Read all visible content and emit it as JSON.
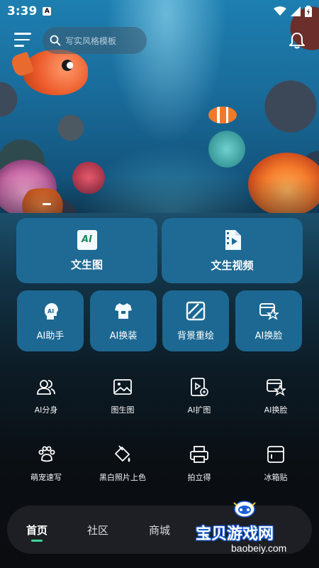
{
  "status_bar": {
    "time": "3:39",
    "badge": "A"
  },
  "header": {
    "search_placeholder": "写实风格模板"
  },
  "big_tiles": [
    {
      "label": "文生图",
      "icon": "ai-text-image-icon",
      "icon_text": "AI"
    },
    {
      "label": "文生视频",
      "icon": "text-video-icon"
    }
  ],
  "mid_tiles": [
    {
      "label": "AI助手",
      "icon": "ai-assistant-icon"
    },
    {
      "label": "AI换装",
      "icon": "outfit-icon"
    },
    {
      "label": "背景重绘",
      "icon": "background-repaint-icon"
    },
    {
      "label": "AI换脸",
      "icon": "face-swap-icon"
    }
  ],
  "grid_items": [
    {
      "label": "AI分身",
      "icon": "clone-users-icon"
    },
    {
      "label": "图生图",
      "icon": "image-icon"
    },
    {
      "label": "AI扩图",
      "icon": "expand-image-icon"
    },
    {
      "label": "AI换脸",
      "icon": "face-swap-icon"
    },
    {
      "label": "萌宠速写",
      "icon": "paw-icon"
    },
    {
      "label": "黑白照片上色",
      "icon": "paint-bucket-icon"
    },
    {
      "label": "拍立得",
      "icon": "printer-icon"
    },
    {
      "label": "冰箱贴",
      "icon": "sticker-icon"
    }
  ],
  "bottom_nav": [
    {
      "label": "首页",
      "active": true
    },
    {
      "label": "社区",
      "active": false
    },
    {
      "label": "商城",
      "active": false
    }
  ],
  "watermark": {
    "title": "宝贝游戏网",
    "url": "baobeiy.com"
  },
  "colors": {
    "tile": "#1e6a94",
    "nav_accent": "#3fd79b",
    "nav_bg": "#1d1f24"
  }
}
